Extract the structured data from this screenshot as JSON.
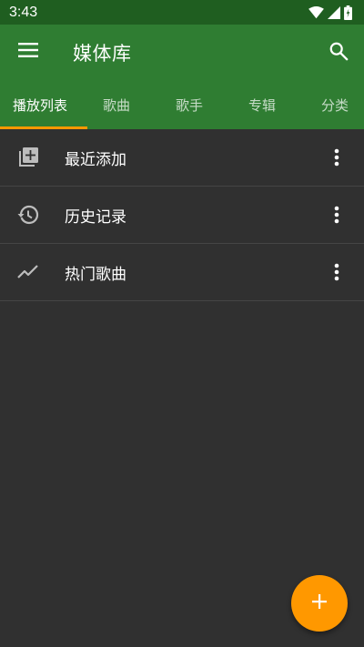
{
  "status_bar": {
    "time": "3:43",
    "icons": [
      "wifi-icon",
      "signal-icon",
      "battery-icon"
    ]
  },
  "app_bar": {
    "title": "媒体库",
    "menu_icon": "menu-icon",
    "search_icon": "search-icon"
  },
  "tabs": [
    {
      "label": "播放列表",
      "active": true
    },
    {
      "label": "歌曲",
      "active": false
    },
    {
      "label": "歌手",
      "active": false
    },
    {
      "label": "专辑",
      "active": false
    },
    {
      "label": "分类",
      "active": false
    }
  ],
  "playlists": [
    {
      "label": "最近添加",
      "icon": "playlist-add-icon"
    },
    {
      "label": "历史记录",
      "icon": "history-icon"
    },
    {
      "label": "热门歌曲",
      "icon": "trending-icon"
    }
  ],
  "fab": {
    "icon": "add-icon"
  },
  "colors": {
    "status_bar": "#1f5e20",
    "primary": "#2f7d32",
    "accent": "#ff9800",
    "background": "#303030"
  }
}
